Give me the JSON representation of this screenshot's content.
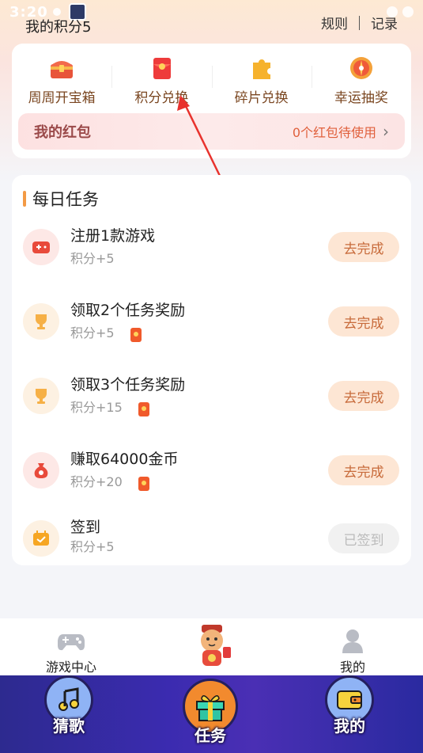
{
  "status_bar": {
    "time": "3:20"
  },
  "header": {
    "points_label": "我的积分5",
    "rules_link": "规则",
    "records_link": "记录"
  },
  "exchange": {
    "items": [
      {
        "label": "周周开宝箱",
        "icon": "treasure-chest-icon"
      },
      {
        "label": "积分兑换",
        "icon": "red-envelope-icon"
      },
      {
        "label": "碎片兑换",
        "icon": "puzzle-piece-icon"
      },
      {
        "label": "幸运抽奖",
        "icon": "lucky-wheel-icon"
      }
    ],
    "redpack_title": "我的红包",
    "redpack_status": "0个红包待使用"
  },
  "tasks": {
    "title": "每日任务",
    "items": [
      {
        "name": "注册1款游戏",
        "reward": "积分+5",
        "button": "去完成",
        "icon": "gamepad-icon",
        "has_redpack": false
      },
      {
        "name": "领取2个任务奖励",
        "reward": "积分+5",
        "button": "去完成",
        "icon": "trophy-icon",
        "has_redpack": true
      },
      {
        "name": "领取3个任务奖励",
        "reward": "积分+15",
        "button": "去完成",
        "icon": "trophy-icon",
        "has_redpack": true
      },
      {
        "name": "赚取64000金币",
        "reward": "积分+20",
        "button": "去完成",
        "icon": "money-bag-icon",
        "has_redpack": true
      },
      {
        "name": "签到",
        "reward": "积分+5",
        "button": "已签到",
        "icon": "calendar-check-icon",
        "has_redpack": false
      }
    ]
  },
  "bottom_nav": {
    "items": [
      {
        "label": "游戏中心",
        "icon": "gamepad-icon"
      },
      {
        "label": "",
        "icon": "mascot-icon"
      },
      {
        "label": "我的",
        "icon": "user-icon"
      }
    ]
  },
  "system_bar": {
    "items": [
      {
        "label": "猜歌",
        "icon": "music-note-icon"
      },
      {
        "label": "任务",
        "icon": "gift-box-icon"
      },
      {
        "label": "我的",
        "icon": "wallet-icon"
      }
    ]
  },
  "colors": {
    "accent": "#f39a45",
    "button_bg": "#fde6d4",
    "button_text": "#c86b3b",
    "redpack_text": "#e0603c"
  }
}
